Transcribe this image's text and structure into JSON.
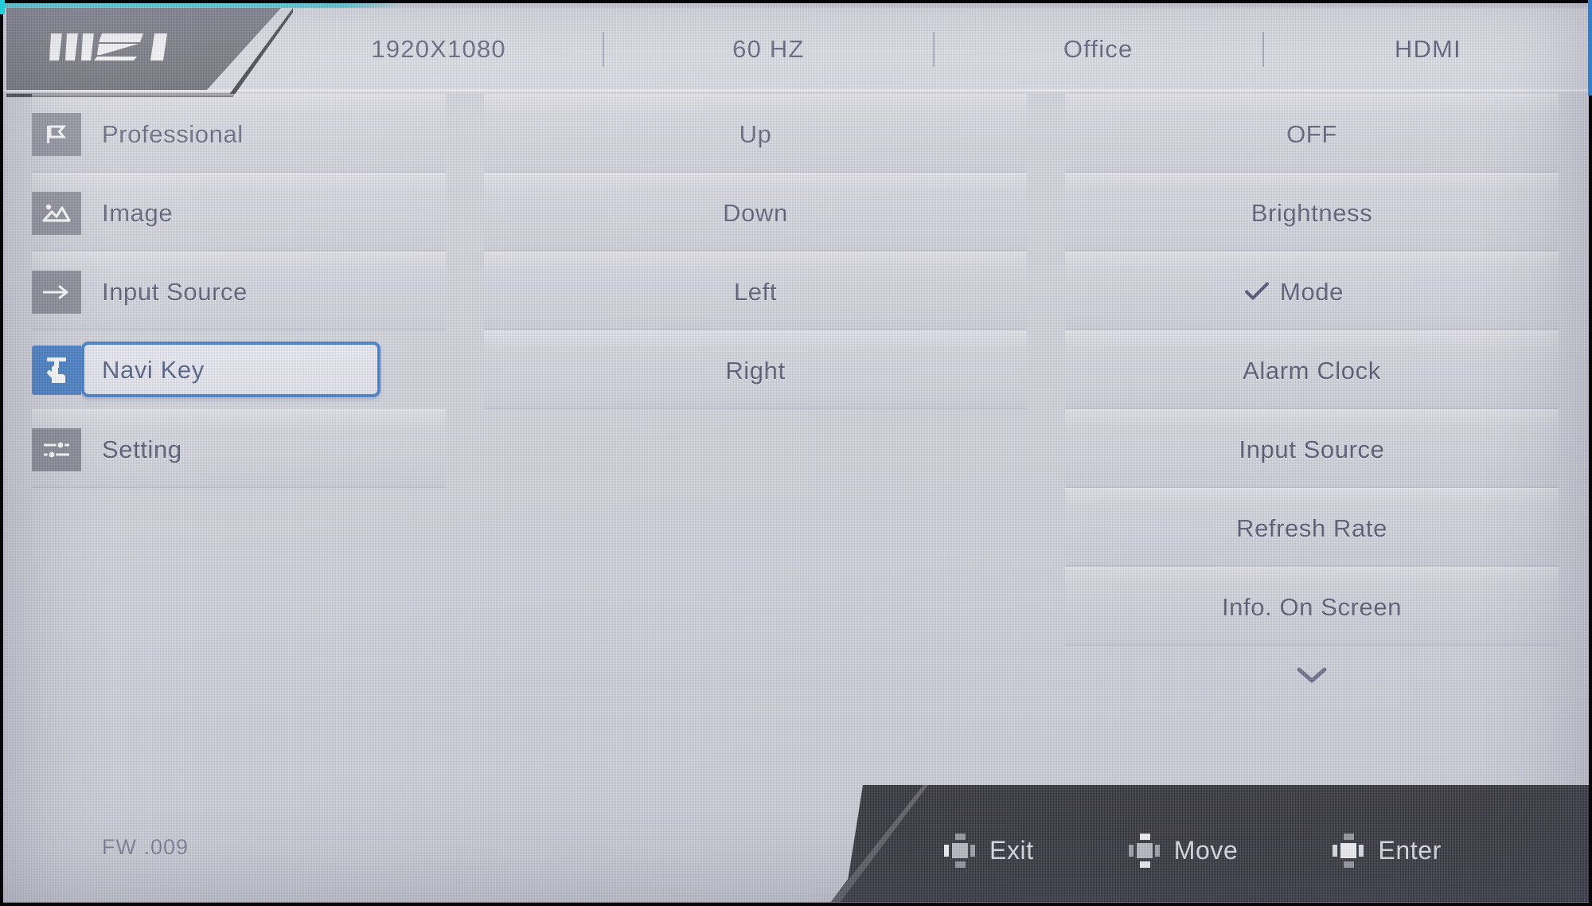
{
  "brand": "MSI",
  "colors": {
    "accent_cyan": "#22cfd6",
    "selection_blue": "#2f6fbb",
    "icon_tile_gray": "#7c7c88",
    "panel_bg": "#cdcdd6",
    "text": "#454560",
    "bottom_bar": "#141419"
  },
  "header": {
    "resolution": "1920X1080",
    "refresh_rate": "60  HZ",
    "mode": "Office",
    "input": "HDMI"
  },
  "menu": {
    "items": [
      {
        "label": "Professional",
        "icon": "professional-flag-icon",
        "selected": false
      },
      {
        "label": "Image",
        "icon": "image-picture-icon",
        "selected": false
      },
      {
        "label": "Input Source",
        "icon": "arrow-right-icon",
        "selected": false
      },
      {
        "label": "Navi Key",
        "icon": "navi-key-hand-icon",
        "selected": true
      },
      {
        "label": "Setting",
        "icon": "sliders-icon",
        "selected": false
      }
    ]
  },
  "directions": {
    "items": [
      {
        "label": "Up"
      },
      {
        "label": "Down"
      },
      {
        "label": "Left"
      },
      {
        "label": "Right"
      }
    ]
  },
  "assignments": {
    "items": [
      {
        "label": "OFF",
        "checked": false
      },
      {
        "label": "Brightness",
        "checked": false
      },
      {
        "label": "Mode",
        "checked": true
      },
      {
        "label": "Alarm Clock",
        "checked": false
      },
      {
        "label": "Input Source",
        "checked": false
      },
      {
        "label": "Refresh Rate",
        "checked": false
      },
      {
        "label": "Info. On Screen",
        "checked": false
      }
    ],
    "scroll_more_icon": "chevron-down-icon"
  },
  "footer": {
    "firmware": "FW .009",
    "hints": [
      {
        "label": "Exit",
        "icon": "joystick-left-icon"
      },
      {
        "label": "Move",
        "icon": "joystick-updown-icon"
      },
      {
        "label": "Enter",
        "icon": "joystick-press-icon"
      }
    ]
  }
}
